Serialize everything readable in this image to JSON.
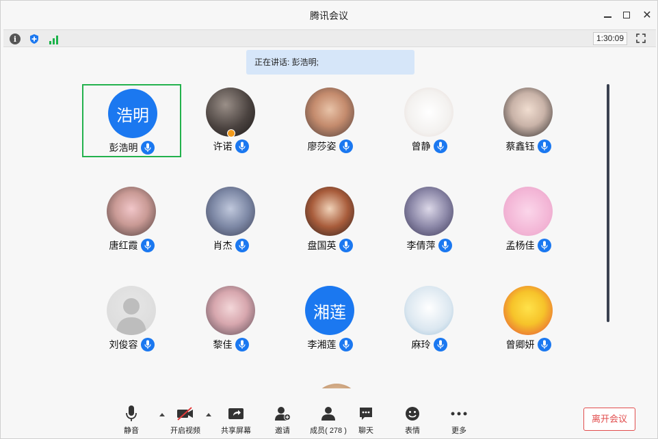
{
  "window": {
    "title": "腾讯会议"
  },
  "statusbar": {
    "timer": "1:30:09"
  },
  "speaking": {
    "text": "正在讲话: 彭浩明;"
  },
  "participants": [
    {
      "name": "彭浩明",
      "avatar_text": "浩明",
      "active": true
    },
    {
      "name": "许诺"
    },
    {
      "name": "廖莎姿"
    },
    {
      "name": "曾静"
    },
    {
      "name": "蔡鑫钰"
    },
    {
      "name": "唐红霞"
    },
    {
      "name": "肖杰"
    },
    {
      "name": "盘国英"
    },
    {
      "name": "李倩萍"
    },
    {
      "name": "孟杨佳"
    },
    {
      "name": "刘俊容"
    },
    {
      "name": "黎佳"
    },
    {
      "name": "李湘莲",
      "avatar_text": "湘莲"
    },
    {
      "name": "麻玲"
    },
    {
      "name": "曾卿妍"
    }
  ],
  "toolbar": {
    "mute": "静音",
    "video": "开启视频",
    "share": "共享屏幕",
    "invite": "邀请",
    "members": "成员( 278 )",
    "chat": "聊天",
    "reactions": "表情",
    "more": "更多",
    "leave": "离开会议"
  },
  "colors": {
    "accent": "#1b78f0",
    "active_border": "#22b14c",
    "leave": "#e14b4b"
  }
}
